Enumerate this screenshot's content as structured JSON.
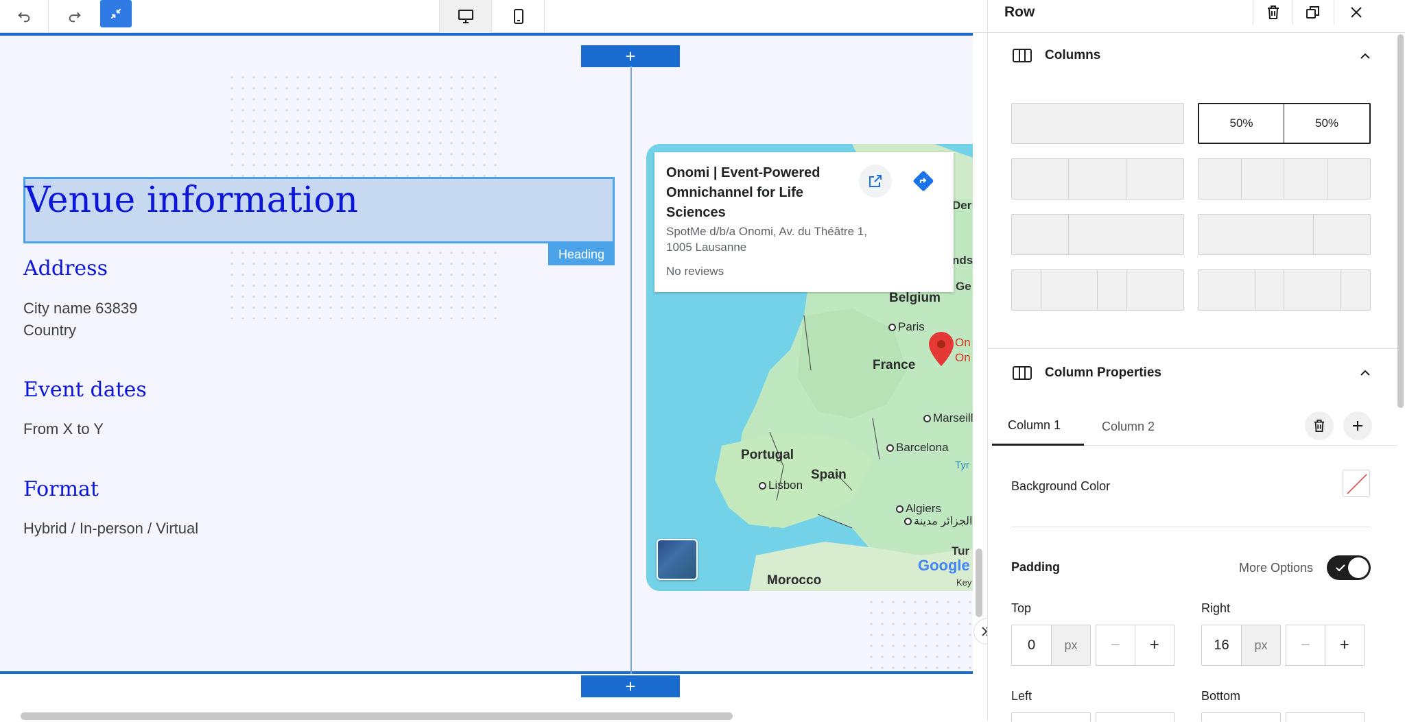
{
  "toolbar": {
    "undo_icon": "undo-icon",
    "redo_icon": "redo-icon",
    "collapse_icon": "minimize-icon",
    "device_desktop_icon": "desktop-icon",
    "device_mobile_icon": "mobile-icon",
    "active_color": "#2f7ae5"
  },
  "canvas": {
    "add_section_label": "+",
    "heading_badge": "Heading",
    "heading": "Venue information",
    "sections": [
      {
        "title": "Address",
        "lines": [
          "City name 63839",
          "Country"
        ]
      },
      {
        "title": "Event dates",
        "lines": [
          "From X to Y"
        ]
      },
      {
        "title": "Format",
        "lines": [
          "Hybrid / In-person / Virtual"
        ]
      }
    ],
    "title_color": "#0b16d8",
    "row_border_color": "#1a6bd0"
  },
  "map": {
    "card": {
      "title": "Onomi | Event-Powered Omnichannel for Life Sciences",
      "address": "SpotMe d/b/a Onomi, Av. du Théâtre 1, 1005 Lausanne",
      "reviews": "No reviews"
    },
    "countries": [
      "Belgium",
      "France",
      "Portugal",
      "Spain",
      "Morocco"
    ],
    "cities": [
      "Paris",
      "Marseill",
      "Barcelona",
      "Lisbon",
      "Algiers"
    ],
    "algiers_arabic": "الجزائر مدينة",
    "partial_labels": [
      "Der",
      "nds",
      "Ge",
      "On",
      "On",
      "Tyr",
      "Tur",
      "Key"
    ],
    "google_logo": "Google",
    "pin_color": "#e53935"
  },
  "panel": {
    "title": "Row",
    "header_icons": [
      "trash-icon",
      "duplicate-icon",
      "close-icon"
    ],
    "columns_section": "Columns",
    "layout_selected": [
      "50%",
      "50%"
    ],
    "column_properties_section": "Column Properties",
    "tabs": [
      "Column 1",
      "Column 2"
    ],
    "background_color_label": "Background Color",
    "padding_label": "Padding",
    "more_options_label": "More Options",
    "more_options_on": true,
    "padding": {
      "top": {
        "label": "Top",
        "value": "0",
        "unit": "px"
      },
      "right": {
        "label": "Right",
        "value": "16",
        "unit": "px"
      },
      "left": {
        "label": "Left"
      },
      "bottom": {
        "label": "Bottom"
      }
    },
    "stepper_minus": "−",
    "stepper_plus": "+"
  }
}
